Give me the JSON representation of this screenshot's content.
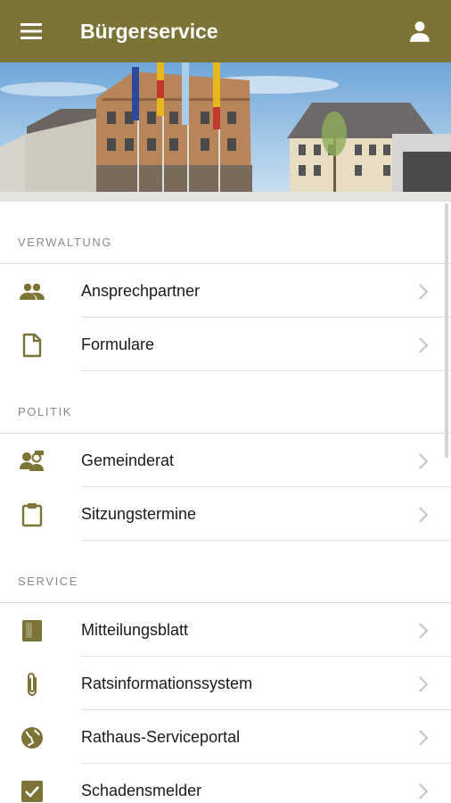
{
  "header": {
    "title": "Bürgerservice",
    "menu_icon": "menu-icon",
    "account_icon": "person-icon"
  },
  "colors": {
    "appbar": "#7b7436",
    "icon": "#7b7436"
  },
  "sections": [
    {
      "title": "VERWALTUNG",
      "items": [
        {
          "label": "Ansprechpartner",
          "icon": "people-icon"
        },
        {
          "label": "Formulare",
          "icon": "document-icon"
        }
      ]
    },
    {
      "title": "POLITIK",
      "items": [
        {
          "label": "Gemeinderat",
          "icon": "group-chat-icon"
        },
        {
          "label": "Sitzungstermine",
          "icon": "clipboard-icon"
        }
      ]
    },
    {
      "title": "SERVICE",
      "items": [
        {
          "label": "Mitteilungsblatt",
          "icon": "book-icon"
        },
        {
          "label": "Ratsinformationssystem",
          "icon": "paperclip-icon"
        },
        {
          "label": "Rathaus-Serviceportal",
          "icon": "globe-icon"
        },
        {
          "label": "Schadensmelder",
          "icon": "checkbox-icon"
        }
      ]
    }
  ]
}
